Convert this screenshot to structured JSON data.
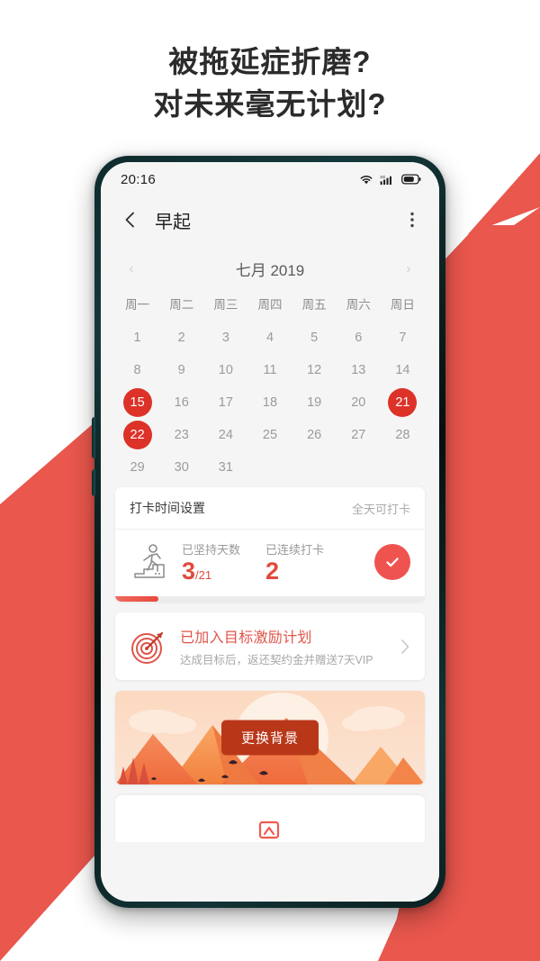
{
  "headline": {
    "line1": "被拖延症折磨?",
    "line2": "对未来毫无计划?"
  },
  "colors": {
    "background_red": "#E9574D",
    "calendar_highlight": "#DC3228",
    "accent_coral": "#EF5350",
    "stat_number": "#E04A3C",
    "banner_button": "#B93719"
  },
  "phone": {
    "statusbar": {
      "time": "20:16",
      "icons": [
        "wifi-icon",
        "signal-4g-icon",
        "battery-icon"
      ]
    },
    "appbar": {
      "back_icon": "chevron-left-icon",
      "title": "早起",
      "more_icon": "more-vertical-icon"
    },
    "calendar": {
      "prev_arrow": "‹",
      "next_arrow": "›",
      "month_label": "七月 2019",
      "weekdays": [
        "周一",
        "周二",
        "周三",
        "周四",
        "周五",
        "周六",
        "周日"
      ],
      "days": [
        1,
        2,
        3,
        4,
        5,
        6,
        7,
        8,
        9,
        10,
        11,
        12,
        13,
        14,
        15,
        16,
        17,
        18,
        19,
        20,
        21,
        22,
        23,
        24,
        25,
        26,
        27,
        28,
        29,
        30,
        31
      ],
      "highlighted_days": [
        15,
        21,
        22
      ]
    },
    "checkin_card": {
      "setting_label": "打卡时间设置",
      "setting_value": "全天可打卡",
      "icon": "runner-stairs-icon",
      "stats": [
        {
          "label": "已坚持天数",
          "value": "3",
          "suffix": "/21"
        },
        {
          "label": "已连续打卡",
          "value": "2",
          "suffix": ""
        }
      ],
      "check_button_icon": "check-circle-icon",
      "progress_percent": 14
    },
    "goal_card": {
      "icon": "target-dartboard-icon",
      "title": "已加入目标激励计划",
      "subtitle": "达成目标后，返还契约金并赠送7天VIP",
      "arrow_icon": "chevron-right-icon"
    },
    "banner": {
      "button_label": "更换背景",
      "illustration": "mountain-sunset-illustration"
    },
    "peek_card": {
      "icon": "image-edit-icon"
    }
  }
}
